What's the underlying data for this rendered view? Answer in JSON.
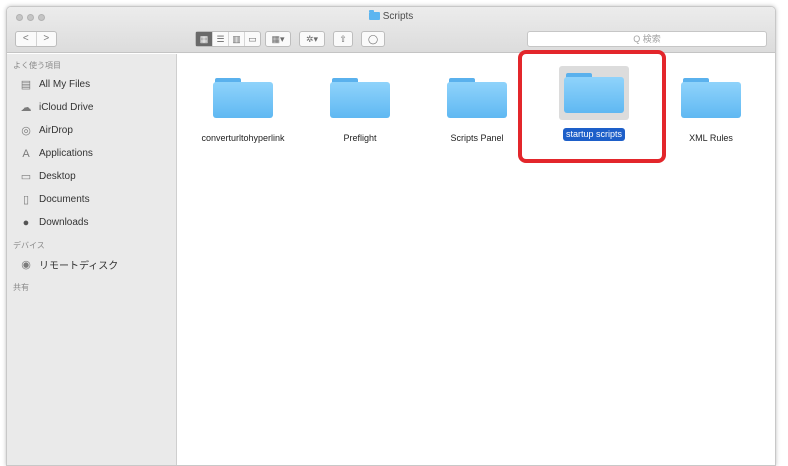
{
  "window": {
    "title": "Scripts"
  },
  "nav": {
    "back": "<",
    "forward": ">"
  },
  "toolbar": {
    "view_icon": "▦",
    "view_list": "☰",
    "view_columns": "▥",
    "view_coverflow": "▭",
    "arrange": "▦▾",
    "action": "✲▾",
    "share": "⇧",
    "tags": "◯"
  },
  "search": {
    "text": "Q 検索"
  },
  "sidebar": {
    "favorites_header": "よく使う項目",
    "favorites": [
      {
        "label": "All My Files",
        "icon": "all-my-files-icon"
      },
      {
        "label": "iCloud Drive",
        "icon": "cloud-icon"
      },
      {
        "label": "AirDrop",
        "icon": "airdrop-icon"
      },
      {
        "label": "Applications",
        "icon": "applications-icon"
      },
      {
        "label": "Desktop",
        "icon": "desktop-icon"
      },
      {
        "label": "Documents",
        "icon": "documents-icon"
      },
      {
        "label": "Downloads",
        "icon": "downloads-icon"
      }
    ],
    "devices_header": "デバイス",
    "devices": [
      {
        "label": "リモートディスク",
        "icon": "remote-disc-icon"
      }
    ],
    "shared_header": "共有"
  },
  "files": [
    {
      "name": "converturltohyperlink",
      "selected": false
    },
    {
      "name": "Preflight",
      "selected": false
    },
    {
      "name": "Scripts Panel",
      "selected": false
    },
    {
      "name": "startup scripts",
      "selected": true
    },
    {
      "name": "XML Rules",
      "selected": false
    }
  ],
  "colors": {
    "selection": "#1d5fc9",
    "folder": "#5fb8f2",
    "highlight_box": "#e3262b"
  }
}
